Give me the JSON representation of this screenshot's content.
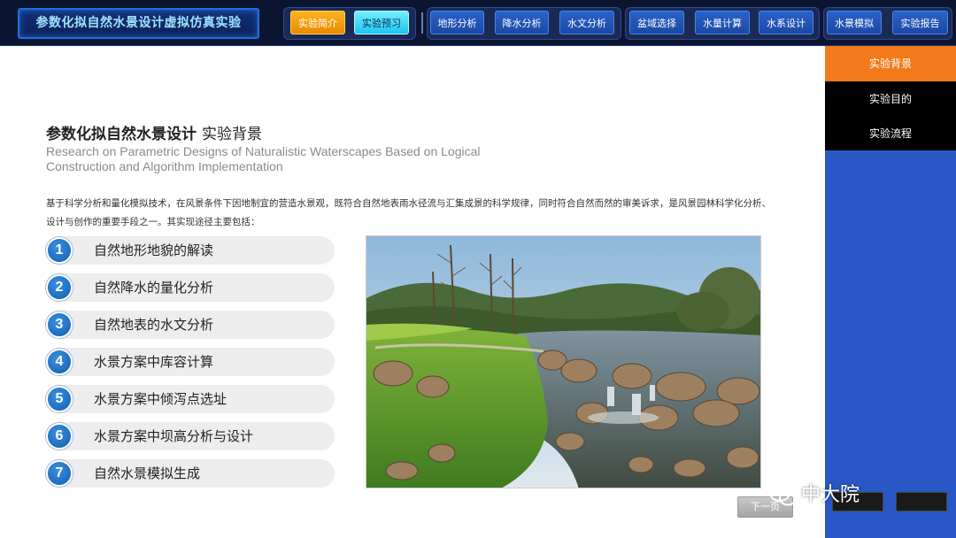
{
  "app": {
    "title": "参数化拟自然水景设计虚拟仿真实验"
  },
  "toolbar": {
    "intro_label": "实验简介",
    "preview_label": "实验预习",
    "terrain_label": "地形分析",
    "rainfall_label": "降水分析",
    "hydrology_label": "水文分析",
    "basin_label": "盆域选择",
    "water_calc_label": "水量计算",
    "water_system_label": "水系设计",
    "waterscape_sim_label": "水景模拟",
    "report_label": "实验报告"
  },
  "sidebar": {
    "items": [
      {
        "label": "实验背景",
        "active": true
      },
      {
        "label": "实验目的",
        "active": false
      },
      {
        "label": "实验流程",
        "active": false
      }
    ]
  },
  "main": {
    "title": "参数化拟自然水景设计",
    "subtitle": "实验背景",
    "english_title": "Research on Parametric Designs of Naturalistic Waterscapes Based on Logical Construction and Algorithm Implementation",
    "intro": "基于科学分析和量化模拟技术，在风景条件下因地制宜的营造水景观，既符合自然地表雨水径流与汇集成景的科学规律，同时符合自然而然的审美诉求，是风景园林科学化分析、设计与创作的重要手段之一。其实现途径主要包括：",
    "steps": [
      {
        "num": "1",
        "label": "自然地形地貌的解读"
      },
      {
        "num": "2",
        "label": "自然降水的量化分析"
      },
      {
        "num": "3",
        "label": "自然地表的水文分析"
      },
      {
        "num": "4",
        "label": "水景方案中库容计算"
      },
      {
        "num": "5",
        "label": "水景方案中倾泻点选址"
      },
      {
        "num": "6",
        "label": "水景方案中坝高分析与设计"
      },
      {
        "num": "7",
        "label": "自然水景模拟生成"
      }
    ],
    "next_label": "下一页"
  },
  "watermark": {
    "text": "中大院"
  },
  "colors": {
    "topbar_bg": "#0c1530",
    "accent_orange": "#f27a1a",
    "sidebar_blue": "#2a57c6",
    "step_blue": "#1e6fc4"
  }
}
